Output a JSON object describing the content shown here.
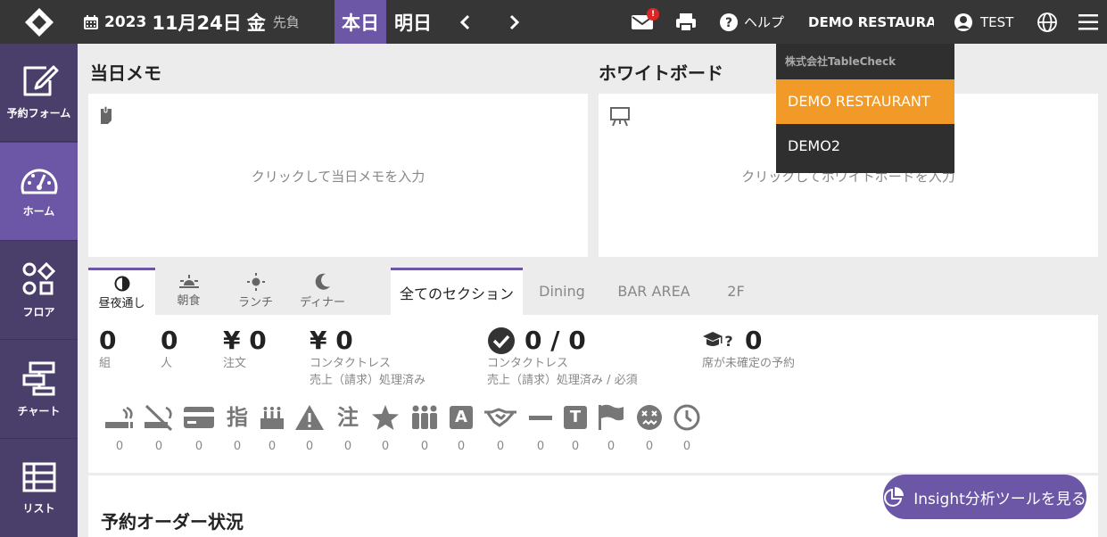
{
  "header": {
    "year": "2023",
    "month_day": "11月24日",
    "weekday": "金",
    "rokuyo": "先負",
    "today_label": "本日",
    "tomorrow_label": "明日",
    "mail_badge": "!",
    "help_label": "ヘルプ",
    "restaurant_label": "DEMO RESTAURANT",
    "user_label": "TEST"
  },
  "sidebar": {
    "items": [
      {
        "label": "予約フォーム",
        "icon": "edit-icon"
      },
      {
        "label": "ホーム",
        "icon": "dashboard-icon"
      },
      {
        "label": "フロア",
        "icon": "floor-shapes-icon"
      },
      {
        "label": "チャート",
        "icon": "gantt-chart-icon"
      },
      {
        "label": "リスト",
        "icon": "table-list-icon"
      }
    ]
  },
  "memo": {
    "title": "当日メモ",
    "placeholder": "クリックして当日メモを入力"
  },
  "whiteboard": {
    "title": "ホワイトボード",
    "placeholder": "クリックしてホワイトボードを入力"
  },
  "dropdown": {
    "company": "株式会社TableCheck",
    "items": [
      "DEMO RESTAURANT",
      "DEMO2"
    ]
  },
  "meal_tabs": [
    "昼夜通し",
    "朝食",
    "ランチ",
    "ディナー"
  ],
  "section_tabs": [
    "全てのセクション",
    "Dining",
    "BAR AREA",
    "2F"
  ],
  "stats": {
    "groups": {
      "value": "0",
      "label": "組"
    },
    "people": {
      "value": "0",
      "label": "人"
    },
    "orders": {
      "value": "¥ 0",
      "label": "注文"
    },
    "contactless": {
      "value": "¥ 0",
      "label1": "コンタクトレス",
      "label2": "売上（請求）処理済み"
    },
    "contactless_ratio": {
      "value": "0 / 0",
      "label1": "コンタクトレス",
      "label2": "売上（請求）処理済み / 必須"
    },
    "unassigned": {
      "value": "0",
      "label": "席が未確定の予約"
    }
  },
  "badges": [
    {
      "icon": "smoking-icon",
      "count": "0"
    },
    {
      "icon": "no-smoking-icon",
      "count": "0"
    },
    {
      "icon": "credit-card-icon",
      "count": "0"
    },
    {
      "icon": "nominated-icon",
      "count": "0",
      "glyph": "指"
    },
    {
      "icon": "birthday-cake-icon",
      "count": "0"
    },
    {
      "icon": "warning-icon",
      "count": "0"
    },
    {
      "icon": "note-icon",
      "count": "0",
      "glyph": "注"
    },
    {
      "icon": "star-icon",
      "count": "0"
    },
    {
      "icon": "group-icon",
      "count": "0"
    },
    {
      "icon": "a-badge-icon",
      "count": "0",
      "glyph": "A"
    },
    {
      "icon": "handshake-icon",
      "count": "0"
    },
    {
      "icon": "minus-icon",
      "count": "0"
    },
    {
      "icon": "t-badge-icon",
      "count": "0",
      "glyph": "T"
    },
    {
      "icon": "flag-icon",
      "count": "0"
    },
    {
      "icon": "dizzy-face-icon",
      "count": "0"
    },
    {
      "icon": "clock-icon",
      "count": "0"
    }
  ],
  "order_status": {
    "title": "予約オーダー状況"
  },
  "insight": {
    "label": "Insight分析ツールを見る"
  },
  "colors": {
    "topbar": "#363636",
    "sidebar": "#4a3f6b",
    "accent": "#6b57a5",
    "dropdown_selected": "#f29a27"
  }
}
